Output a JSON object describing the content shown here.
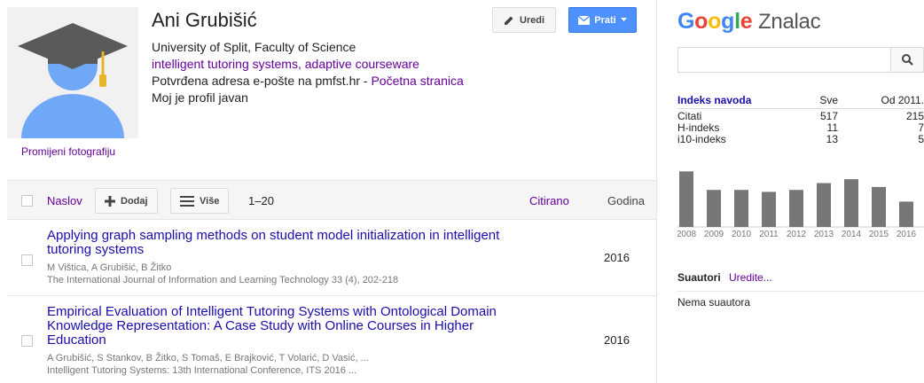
{
  "profile": {
    "name": "Ani Grubišić",
    "affiliation": "University of Split, Faculty of Science",
    "interests": "intelligent tutoring systems, adaptive courseware",
    "email_text": "Potvrđena adresa e-pošte na pmfst.hr - ",
    "homepage_link": "Početna stranica",
    "public_text": "Moj je profil javan",
    "change_photo": "Promijeni fotografiju",
    "edit_label": "Uredi",
    "follow_label": "Prati"
  },
  "toolbar": {
    "title_col": "Naslov",
    "add_label": "Dodaj",
    "more_label": "Više",
    "range": "1–20",
    "cited_col": "Citirano",
    "year_col": "Godina"
  },
  "articles": [
    {
      "title": "Applying graph sampling methods on student model initialization in intelligent tutoring systems",
      "authors": "M Vištica, A Grubišić, B Žitko",
      "venue": "The International Journal of Information and Learning Technology 33 (4), 202-218",
      "year": "2016"
    },
    {
      "title": "Empirical Evaluation of Intelligent Tutoring Systems with Ontological Domain Knowledge Representation: A Case Study with Online Courses in Higher Education",
      "authors": "A Grubišić, S Stankov, B Žitko, S Tomaš, E Brajković, T Volarić, D Vasić, ...",
      "venue": "Intelligent Tutoring Systems: 13th International Conference, ITS 2016 ...",
      "year": "2016"
    }
  ],
  "sidebar": {
    "logo_word": "Google",
    "logo_suffix": "Znalac",
    "search_placeholder": "",
    "metrics_header": [
      "Indeks navoda",
      "Sve",
      "Od 2011."
    ],
    "metrics": [
      {
        "label": "Citati",
        "all": "517",
        "since": "215"
      },
      {
        "label": "H-indeks",
        "all": "11",
        "since": "7"
      },
      {
        "label": "i10-indeks",
        "all": "13",
        "since": "5"
      }
    ],
    "coauthors_title": "Suautori",
    "coauthors_edit": "Uredite...",
    "no_coauthors": "Nema suautora"
  },
  "chart_data": {
    "type": "bar",
    "categories": [
      "2008",
      "2009",
      "2010",
      "2011",
      "2012",
      "2013",
      "2014",
      "2015",
      "2016"
    ],
    "values": [
      57,
      38,
      38,
      36,
      38,
      45,
      49,
      41,
      26
    ],
    "ylim": [
      0,
      60
    ],
    "color": "#777777"
  },
  "colors": {
    "link": "#1a0dab",
    "visited": "#660099",
    "primary_button": "#4d90fe"
  }
}
